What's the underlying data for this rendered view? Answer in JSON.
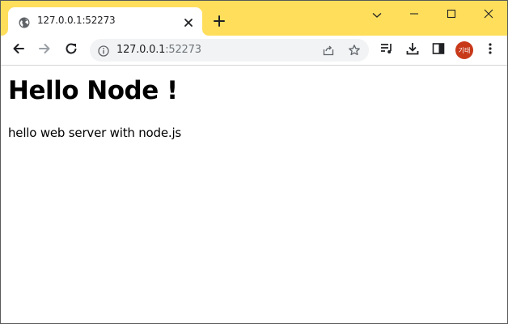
{
  "browser": {
    "tab": {
      "title": "127.0.0.1:52273",
      "favicon": "globe-icon"
    },
    "address_bar": {
      "host": "127.0.0.1",
      "port": ":52273"
    },
    "profile": {
      "initials": "기태",
      "color": "#c8391a"
    },
    "theme": {
      "frame_color": "#ffde5c"
    }
  },
  "page": {
    "heading": "Hello Node !",
    "paragraph": "hello web server with node.js"
  }
}
